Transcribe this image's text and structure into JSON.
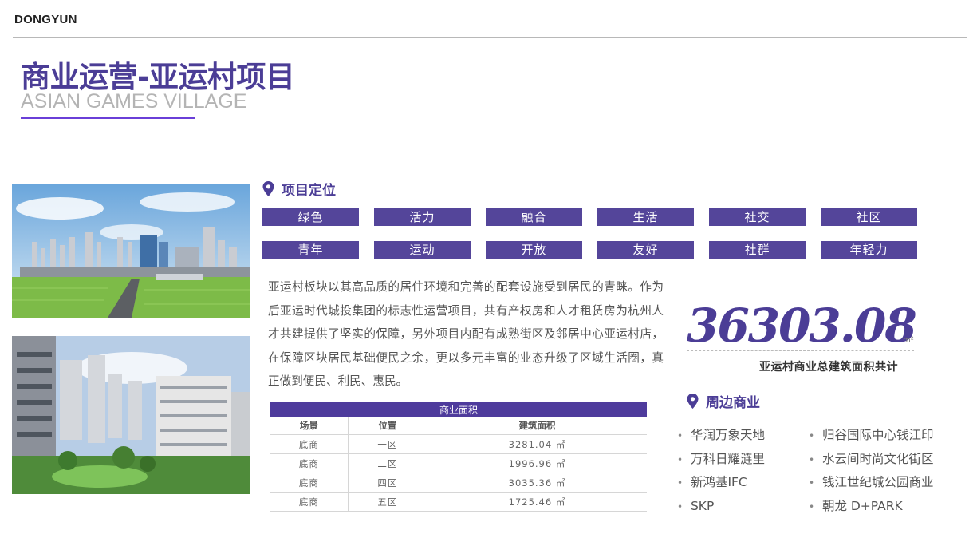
{
  "header": {
    "brand": "DONGYUN",
    "title": "商业运营-亚运村项目",
    "subtitle": "ASIAN GAMES VILLAGE"
  },
  "positioning": {
    "heading": "项目定位",
    "tags": [
      "绿色",
      "活力",
      "融合",
      "生活",
      "社交",
      "社区",
      "青年",
      "运动",
      "开放",
      "友好",
      "社群",
      "年轻力"
    ]
  },
  "description": "亚运村板块以其高品质的居住环境和完善的配套设施受到居民的青睐。作为后亚运时代城投集团的标志性运营项目，共有产权房和人才租赁房为杭州人才共建提供了坚实的保障，另外项目内配有成熟街区及邻居中心亚运村店，在保障区块居民基础便民之余，更以多元丰富的业态升级了区域生活圈，真正做到便民、利民、惠民。",
  "area_table": {
    "caption": "商业面积",
    "headers": [
      "场景",
      "位置",
      "建筑面积"
    ],
    "rows": [
      [
        "底商",
        "一区",
        "3281.04 ㎡"
      ],
      [
        "底商",
        "二区",
        "1996.96 ㎡"
      ],
      [
        "底商",
        "四区",
        "3035.36 ㎡"
      ],
      [
        "底商",
        "五区",
        "1725.46 ㎡"
      ]
    ]
  },
  "total": {
    "value": "36303.08",
    "unit": "m²",
    "caption": "亚运村商业总建筑面积共计"
  },
  "nearby": {
    "heading": "周边商业",
    "bullet": "•",
    "col1": [
      "华润万象天地",
      "万科日耀涟里",
      "新鸿基IFC",
      "SKP"
    ],
    "col2": [
      "归谷国际中心钱江印",
      "水云间时尚文化街区",
      "钱江世纪城公园商业",
      "朝龙 D+PARK"
    ]
  },
  "colors": {
    "accent": "#4b3d96",
    "tag_bg": "#54459a",
    "table_header": "#4e3b9c",
    "title_rule": "#6a3fd8"
  },
  "icons": [
    "location-pin-icon"
  ]
}
